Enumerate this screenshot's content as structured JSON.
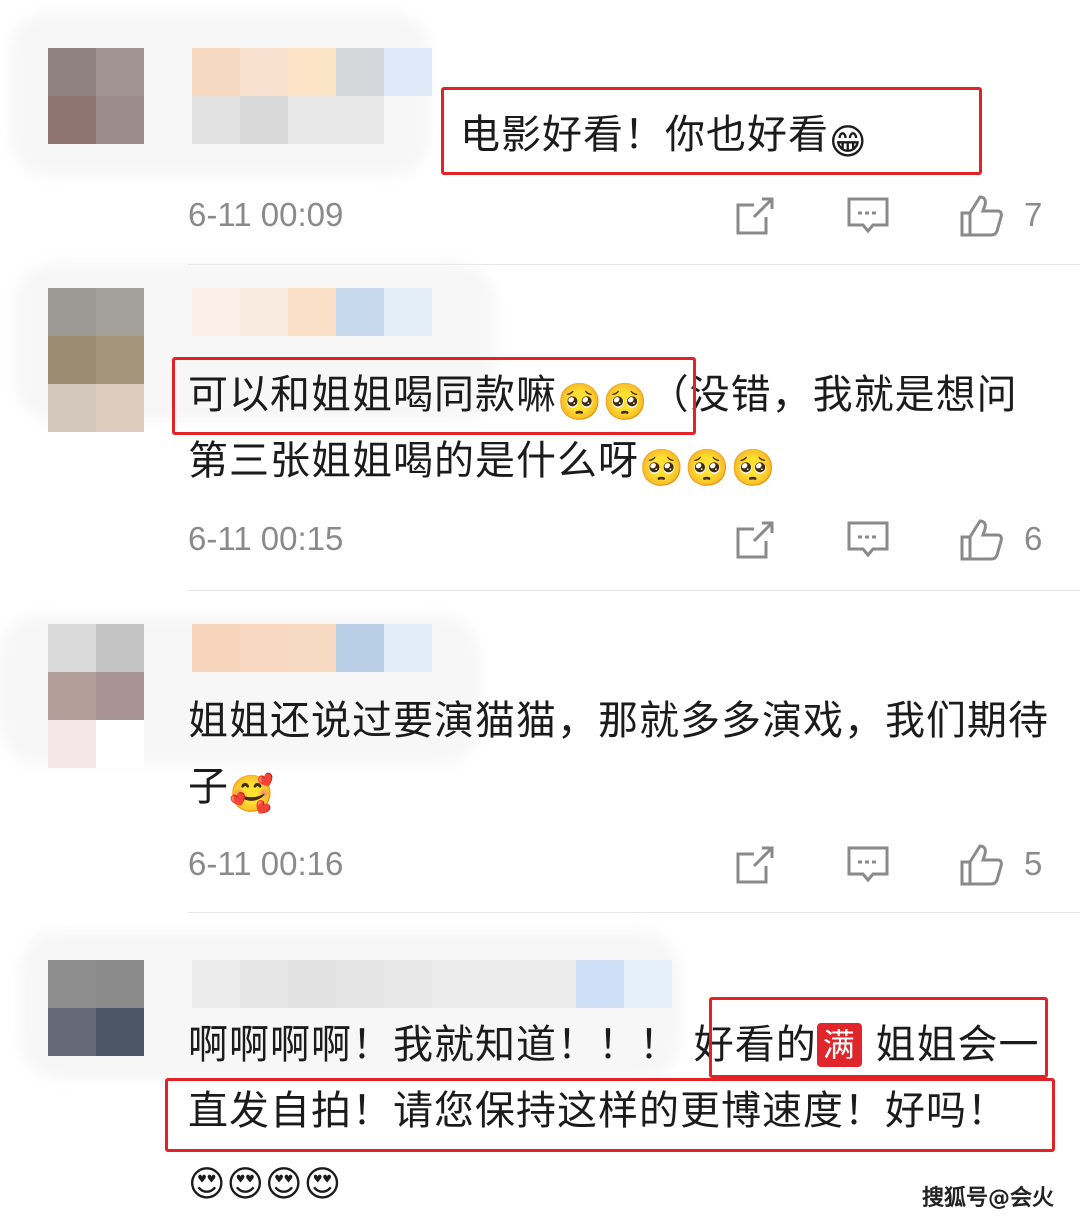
{
  "comments": [
    {
      "text_parts": [
        "电影好看！你也好看",
        "😁"
      ],
      "time": "6-11 00:09",
      "likes": "7"
    },
    {
      "text_parts": [
        "可以和姐姐喝同款嘛",
        "🥺🥺",
        "（没错，我就是想问第三张姐姐喝的是什么呀",
        "🥺🥺🥺"
      ],
      "time": "6-11 00:15",
      "likes": "6"
    },
    {
      "text_parts": [
        "姐姐还说过要演猫猫，那就多多演戏，我们期待子",
        "🥰"
      ],
      "time": "6-11 00:16",
      "likes": "5"
    },
    {
      "text_parts": [
        "啊啊啊啊！我就知道！！！",
        "好看的",
        "满",
        "姐姐会一直发自拍！请您保持这样的更博速度！好吗！",
        "😍😍😍😍"
      ],
      "time": "",
      "likes": ""
    }
  ],
  "actions": {
    "repost_icon": "share-edit-icon",
    "comment_icon": "comment-icon",
    "like_icon": "thumbs-up-icon"
  },
  "watermark": "搜狐号@会火",
  "colors": {
    "highlight_box": "#e32226",
    "meta_text": "#8a8a8a",
    "badge": "#e0262b"
  }
}
